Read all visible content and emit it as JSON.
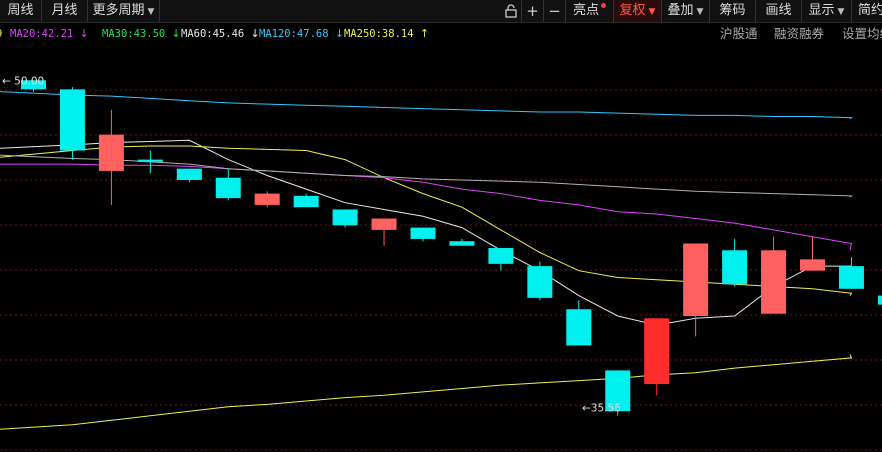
{
  "toolbar": {
    "week": "周线",
    "month": "月线",
    "more_periods": "更多周期",
    "highlight": "亮点",
    "fuquan": "复权",
    "overlay": "叠加",
    "chips": "筹码",
    "draw": "画线",
    "display": "显示",
    "simple": "简约"
  },
  "ma_legend": [
    {
      "label": "MA20:42.21",
      "color": "#e040fb",
      "arrow": "↓"
    },
    {
      "label": "MA30:43.50",
      "color": "#22e05a",
      "arrow": "↓"
    },
    {
      "label": "MA60:45.46",
      "color": "#e8e8e8",
      "arrow": "↓"
    },
    {
      "label": "MA120:47.68",
      "color": "#2ec8ff",
      "arrow": "↓"
    },
    {
      "label": "MA250:38.14",
      "color": "#f0f050",
      "arrow": "↑"
    }
  ],
  "legend_links": {
    "hsgt": "沪股通",
    "margin": "融资融券",
    "settings": "设置均线"
  },
  "colors": {
    "up": "#ff2c2c",
    "up_soft": "#ff6060",
    "down": "#00f0f0",
    "grid": "#6a1818"
  },
  "chart_data": {
    "type": "candlestick",
    "ylim": [
      33.6,
      51.6
    ],
    "high_label": "50.00",
    "low_label": "35.56",
    "candles": [
      {
        "o": 50.0,
        "c": 49.6,
        "h": 50.0,
        "l": 49.5
      },
      {
        "o": 49.6,
        "c": 46.9,
        "h": 49.7,
        "l": 46.5
      },
      {
        "o": 46.0,
        "c": 47.6,
        "h": 48.7,
        "l": 44.5
      },
      {
        "o": 46.5,
        "c": 46.4,
        "h": 46.9,
        "l": 45.9
      },
      {
        "o": 46.1,
        "c": 45.6,
        "h": 46.1,
        "l": 45.5
      },
      {
        "o": 45.7,
        "c": 44.8,
        "h": 46.1,
        "l": 44.7
      },
      {
        "o": 44.5,
        "c": 45.0,
        "h": 45.1,
        "l": 44.4
      },
      {
        "o": 44.9,
        "c": 44.4,
        "h": 45.0,
        "l": 44.4
      },
      {
        "o": 44.3,
        "c": 43.6,
        "h": 44.3,
        "l": 43.5
      },
      {
        "o": 43.4,
        "c": 43.9,
        "h": 43.9,
        "l": 42.7
      },
      {
        "o": 43.5,
        "c": 43.0,
        "h": 43.5,
        "l": 42.9
      },
      {
        "o": 42.9,
        "c": 42.7,
        "h": 43.0,
        "l": 42.7
      },
      {
        "o": 42.6,
        "c": 41.9,
        "h": 42.6,
        "l": 41.6
      },
      {
        "o": 41.8,
        "c": 40.4,
        "h": 42.0,
        "l": 40.3
      },
      {
        "o": 39.9,
        "c": 38.3,
        "h": 40.3,
        "l": 38.3
      },
      {
        "o": 37.2,
        "c": 35.4,
        "h": 37.2,
        "l": 35.2
      },
      {
        "o": 36.6,
        "c": 39.5,
        "h": 39.5,
        "l": 36.1
      },
      {
        "o": 39.6,
        "c": 42.8,
        "h": 42.8,
        "l": 38.7
      },
      {
        "o": 42.5,
        "c": 41.0,
        "h": 43.0,
        "l": 40.9
      },
      {
        "o": 39.7,
        "c": 42.5,
        "h": 43.1,
        "l": 39.7
      },
      {
        "o": 41.6,
        "c": 42.1,
        "h": 43.1,
        "l": 41.6
      },
      {
        "o": 41.8,
        "c": 40.8,
        "h": 42.2,
        "l": 40.8
      },
      {
        "o": 40.5,
        "c": 40.1,
        "h": 40.5,
        "l": 39.7
      }
    ],
    "ma_series": [
      {
        "name": "MA60",
        "color": "#e8e8e8",
        "values": [
          47.0,
          47.15,
          47.25,
          47.3,
          47.35,
          46.5,
          45.8,
          45.2,
          44.6,
          44.3,
          44.0,
          43.5,
          42.5,
          41.6,
          40.5,
          39.6,
          39.2,
          39.5,
          39.6,
          40.9,
          41.8,
          41.8,
          41.0
        ]
      },
      {
        "name": "MA30",
        "color": "#f0f050",
        "values": [
          46.6,
          46.9,
          47.05,
          47.1,
          47.1,
          47.0,
          46.95,
          46.9,
          46.5,
          45.7,
          45.0,
          44.4,
          43.4,
          42.4,
          41.6,
          41.3,
          41.2,
          41.1,
          41.0,
          40.9,
          40.8,
          40.6,
          40.5
        ]
      },
      {
        "name": "MA20",
        "color": "#e040fb",
        "values": [
          46.3,
          46.3,
          46.25,
          46.25,
          46.2,
          46.1,
          46.0,
          45.9,
          45.8,
          45.7,
          45.5,
          45.2,
          45.0,
          44.7,
          44.5,
          44.2,
          44.1,
          43.9,
          43.7,
          43.4,
          43.1,
          42.8,
          42.5
        ]
      },
      {
        "name": "MA120",
        "color": "#2ec8ff",
        "values": [
          49.5,
          49.35,
          49.3,
          49.2,
          49.1,
          49.0,
          48.95,
          48.9,
          48.85,
          48.8,
          48.75,
          48.7,
          48.65,
          48.6,
          48.6,
          48.55,
          48.5,
          48.45,
          48.45,
          48.4,
          48.4,
          48.35,
          48.3
        ]
      },
      {
        "name": "MA250",
        "color": "#f0f050",
        "values": [
          34.6,
          34.8,
          35.0,
          35.2,
          35.4,
          35.6,
          35.7,
          35.85,
          36.0,
          36.1,
          36.25,
          36.4,
          36.55,
          36.65,
          36.75,
          36.85,
          37.0,
          37.1,
          37.3,
          37.45,
          37.6,
          37.75,
          37.9
        ]
      },
      {
        "name": "MA10",
        "color": "#b0b0b0",
        "values": [
          46.7,
          46.55,
          46.5,
          46.4,
          46.3,
          46.1,
          46.0,
          45.9,
          45.8,
          45.75,
          45.65,
          45.6,
          45.55,
          45.5,
          45.4,
          45.3,
          45.2,
          45.1,
          45.05,
          45.0,
          44.95,
          44.9,
          44.85
        ]
      }
    ]
  }
}
